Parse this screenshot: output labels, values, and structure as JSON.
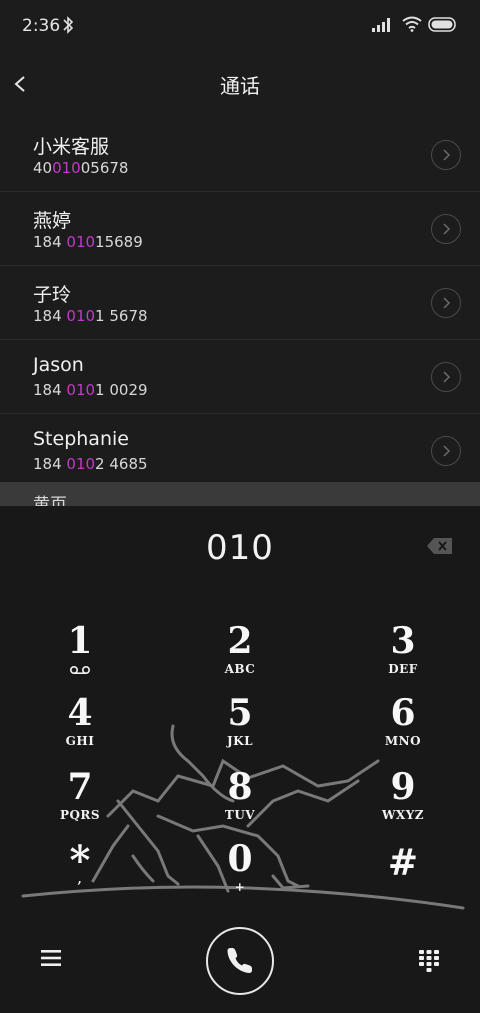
{
  "status_bar": {
    "time": "2:36"
  },
  "header": {
    "title": "通话"
  },
  "contacts": [
    {
      "name": "小米客服",
      "pre": "40",
      "match": "010",
      "post": "05678"
    },
    {
      "name": "燕婷",
      "pre": "184 ",
      "match": "010",
      "post": "15689"
    },
    {
      "name": "子玲",
      "pre": "184 ",
      "match": "010",
      "post": "1 5678"
    },
    {
      "name": "Jason",
      "pre": "184 ",
      "match": "010",
      "post": "1 0029"
    },
    {
      "name": "Stephanie",
      "pre": "184 ",
      "match": "010",
      "post": "2 4685"
    }
  ],
  "section_header": "黄页",
  "dialpad": {
    "input_value": "010",
    "keys": [
      {
        "digit": "1",
        "letters": ""
      },
      {
        "digit": "2",
        "letters": "ABC"
      },
      {
        "digit": "3",
        "letters": "DEF"
      },
      {
        "digit": "4",
        "letters": "GHI"
      },
      {
        "digit": "5",
        "letters": "JKL"
      },
      {
        "digit": "6",
        "letters": "MNO"
      },
      {
        "digit": "7",
        "letters": "PQRS"
      },
      {
        "digit": "8",
        "letters": "TUV"
      },
      {
        "digit": "9",
        "letters": "WXYZ"
      },
      {
        "digit": "*",
        "letters": ","
      },
      {
        "digit": "0",
        "letters": "+"
      },
      {
        "digit": "#",
        "letters": ""
      }
    ]
  },
  "icons": {
    "bluetooth": "bluetooth-icon",
    "signal": "signal-icon",
    "wifi": "wifi-icon",
    "battery": "battery-icon",
    "back": "back-arrow-icon",
    "info": "chevron-right-icon",
    "delete": "backspace-icon",
    "voicemail": "voicemail-icon",
    "menu": "menu-icon",
    "call": "phone-icon",
    "keypad": "keypad-icon"
  },
  "colors": {
    "match_highlight": "#c23ac7",
    "background": "#1c1c1d"
  }
}
